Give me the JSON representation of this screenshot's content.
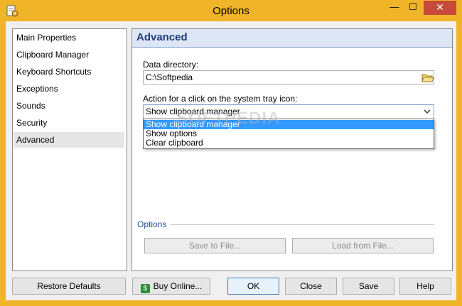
{
  "window": {
    "title": "Options"
  },
  "titlebar": {
    "minimize": "—",
    "maximize": "☐",
    "close": "✕"
  },
  "nav": {
    "items": [
      {
        "label": "Main Properties"
      },
      {
        "label": "Clipboard Manager"
      },
      {
        "label": "Keyboard Shortcuts"
      },
      {
        "label": "Exceptions"
      },
      {
        "label": "Sounds"
      },
      {
        "label": "Security"
      },
      {
        "label": "Advanced"
      }
    ],
    "selected": "Advanced"
  },
  "panel": {
    "title": "Advanced",
    "data_directory_label": "Data directory:",
    "data_directory_value": "C:\\Softpedia",
    "tray_action_label": "Action for a click on the system tray icon:",
    "tray_action_selected": "Show clipboard manager",
    "tray_action_options": [
      "Show clipboard manager",
      "Show options",
      "Clear clipboard"
    ],
    "watermark": "SOFTPEDIA",
    "options_section_label": "Options",
    "save_to_file": "Save to File...",
    "load_from_file": "Load from File..."
  },
  "buttons": {
    "restore_defaults": "Restore Defaults",
    "buy_online": "Buy Online...",
    "buy_icon_glyph": "$",
    "ok": "OK",
    "close": "Close",
    "save": "Save",
    "help": "Help"
  },
  "colors": {
    "frame": "#f0b429",
    "close_button": "#c74a3a",
    "header_bg": "#dce6f4",
    "header_text": "#1e3d7a",
    "highlight": "#3399ff"
  }
}
